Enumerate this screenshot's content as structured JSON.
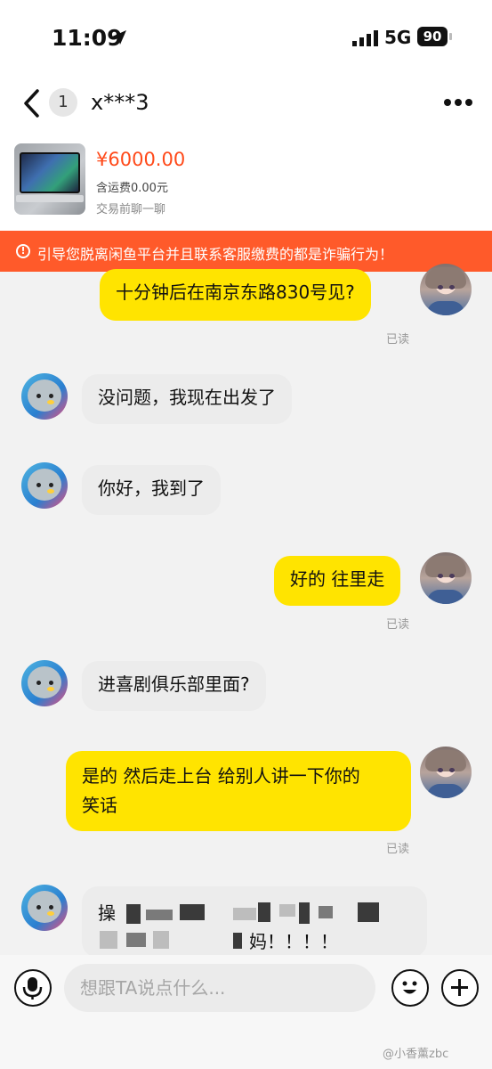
{
  "status_bar": {
    "time": "11:09",
    "network": "5G",
    "battery": "90"
  },
  "header": {
    "unread_count": "1",
    "contact_name": "x***3"
  },
  "product": {
    "price": "¥6000.00",
    "shipping": "含运费0.00元",
    "hint": "交易前聊一聊"
  },
  "warning": {
    "icon": "!",
    "text": "引导您脱离闲鱼平台并且联系客服缴费的都是诈骗行为！"
  },
  "messages": [
    {
      "sender": "me",
      "text": "十分钟后在南京东路830号见?",
      "read": "已读"
    },
    {
      "sender": "them",
      "text": "没问题，我现在出发了"
    },
    {
      "sender": "them",
      "text": "你好，我到了"
    },
    {
      "sender": "me",
      "text": "好的 往里走",
      "read": "已读"
    },
    {
      "sender": "them",
      "text": "进喜剧俱乐部里面?"
    },
    {
      "sender": "me",
      "text_line1": "是的 然后走上台 给别人讲一下你的",
      "text_line2": "笑话",
      "read": "已读"
    },
    {
      "sender": "them",
      "text_line1": "操",
      "text_line2": "妈！！！！"
    }
  ],
  "input": {
    "placeholder": "想跟TA说点什么..."
  },
  "watermark": "@小香薰zbc",
  "colors": {
    "my_bubble": "#ffe400",
    "their_bubble": "#ececec",
    "warning_bg": "#ff5a2a",
    "price": "#ff4a1a"
  },
  "icons": [
    "back-arrow-icon",
    "more-icon",
    "location-arrow-icon",
    "signal-icon",
    "warning-icon",
    "microphone-icon",
    "emoji-icon",
    "plus-icon"
  ]
}
